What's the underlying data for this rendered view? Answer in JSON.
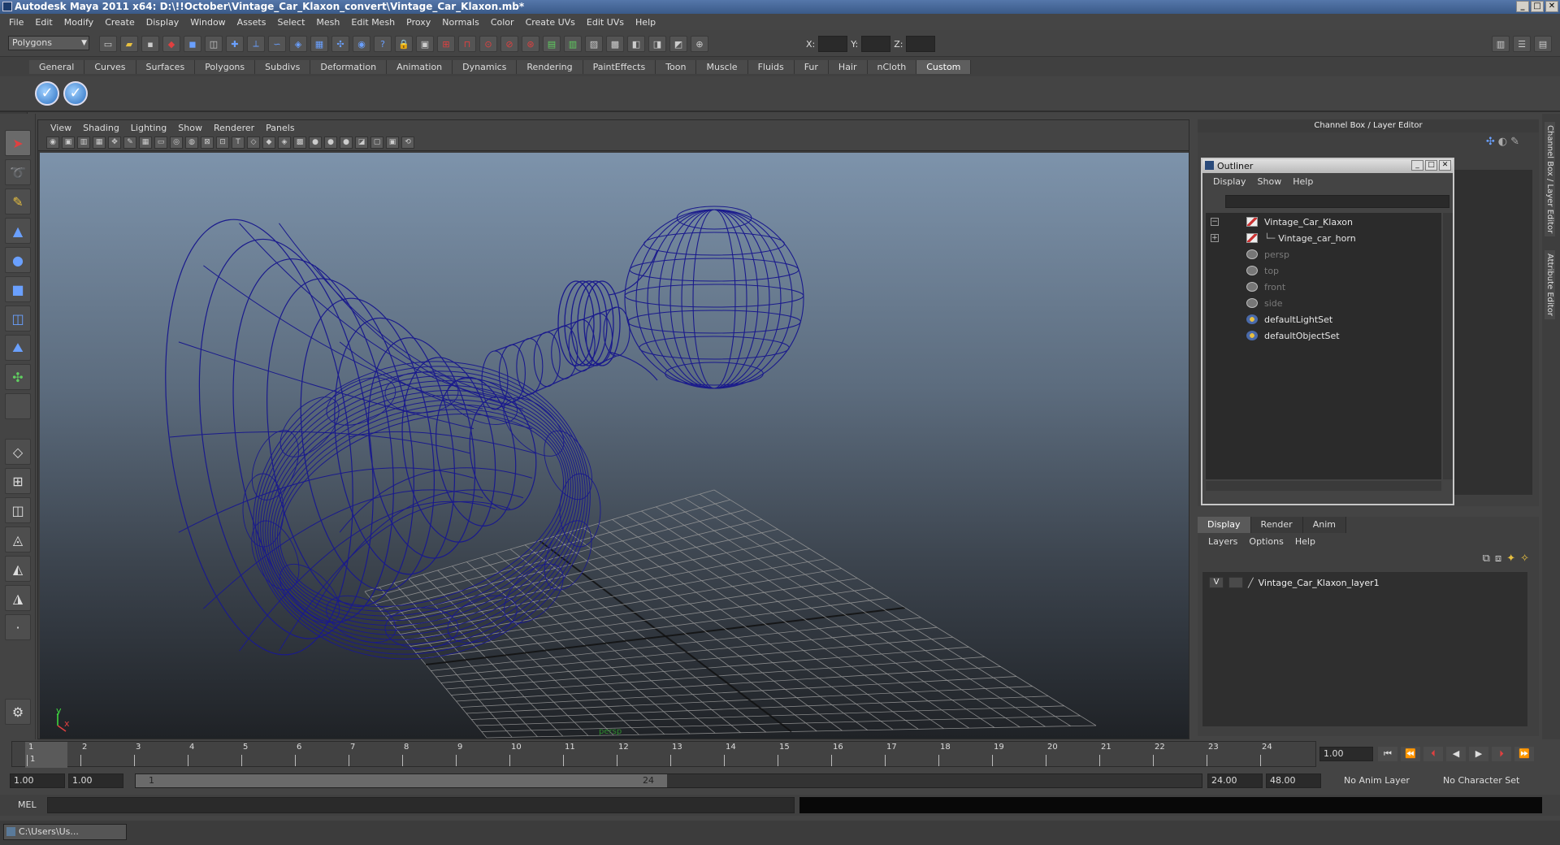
{
  "window": {
    "title": "Autodesk Maya 2011 x64: D:\\!!October\\Vintage_Car_Klaxon_convert\\Vintage_Car_Klaxon.mb*"
  },
  "menubar": [
    "File",
    "Edit",
    "Modify",
    "Create",
    "Display",
    "Window",
    "Assets",
    "Select",
    "Mesh",
    "Edit Mesh",
    "Proxy",
    "Normals",
    "Color",
    "Create UVs",
    "Edit UVs",
    "Help"
  ],
  "toolbar": {
    "mode": "Polygons",
    "x_label": "X:",
    "y_label": "Y:",
    "z_label": "Z:"
  },
  "shelf": {
    "tabs": [
      "General",
      "Curves",
      "Surfaces",
      "Polygons",
      "Subdivs",
      "Deformation",
      "Animation",
      "Dynamics",
      "Rendering",
      "PaintEffects",
      "Toon",
      "Muscle",
      "Fluids",
      "Fur",
      "Hair",
      "nCloth",
      "Custom"
    ],
    "active_tab": "Custom"
  },
  "viewport": {
    "menu": [
      "View",
      "Shading",
      "Lighting",
      "Show",
      "Renderer",
      "Panels"
    ],
    "camera_label": "persp",
    "axis_y": "y",
    "axis_x": "x",
    "wire_color": "#1a1a8c"
  },
  "channel_box": {
    "title": "Channel Box / Layer Editor"
  },
  "outliner": {
    "title": "Outliner",
    "menu": [
      "Display",
      "Show",
      "Help"
    ],
    "items": [
      {
        "label": "Vintage_Car_Klaxon",
        "icon": "mesh-icon"
      },
      {
        "label": "Vintage_car_horn",
        "icon": "mesh-icon"
      },
      {
        "label": "persp",
        "icon": "camera-icon"
      },
      {
        "label": "top",
        "icon": "camera-icon"
      },
      {
        "label": "front",
        "icon": "camera-icon"
      },
      {
        "label": "side",
        "icon": "camera-icon"
      },
      {
        "label": "defaultLightSet",
        "icon": "set-icon"
      },
      {
        "label": "defaultObjectSet",
        "icon": "set-icon"
      }
    ]
  },
  "layer_editor": {
    "tabs": [
      "Display",
      "Render",
      "Anim"
    ],
    "active_tab": "Display",
    "menu": [
      "Layers",
      "Options",
      "Help"
    ],
    "layers": [
      {
        "visible": "V",
        "name": "Vintage_Car_Klaxon_layer1"
      }
    ]
  },
  "side_tabs": [
    "Channel Box / Layer Editor",
    "Attribute Editor"
  ],
  "timeline": {
    "frames": [
      "1",
      "2",
      "3",
      "4",
      "5",
      "6",
      "7",
      "8",
      "9",
      "10",
      "11",
      "12",
      "13",
      "14",
      "15",
      "16",
      "17",
      "18",
      "19",
      "20",
      "21",
      "22",
      "23",
      "24"
    ],
    "current_frame_marker": "1",
    "current_time": "1.00"
  },
  "range": {
    "start": "1.00",
    "playback_start": "1.00",
    "slider_start": "1",
    "slider_end": "24",
    "playback_end": "24.00",
    "end": "48.00",
    "anim_layer": "No Anim Layer",
    "character_set": "No Character Set"
  },
  "command_line": {
    "label": "MEL"
  },
  "taskbar": {
    "item": "C:\\Users\\Us..."
  }
}
